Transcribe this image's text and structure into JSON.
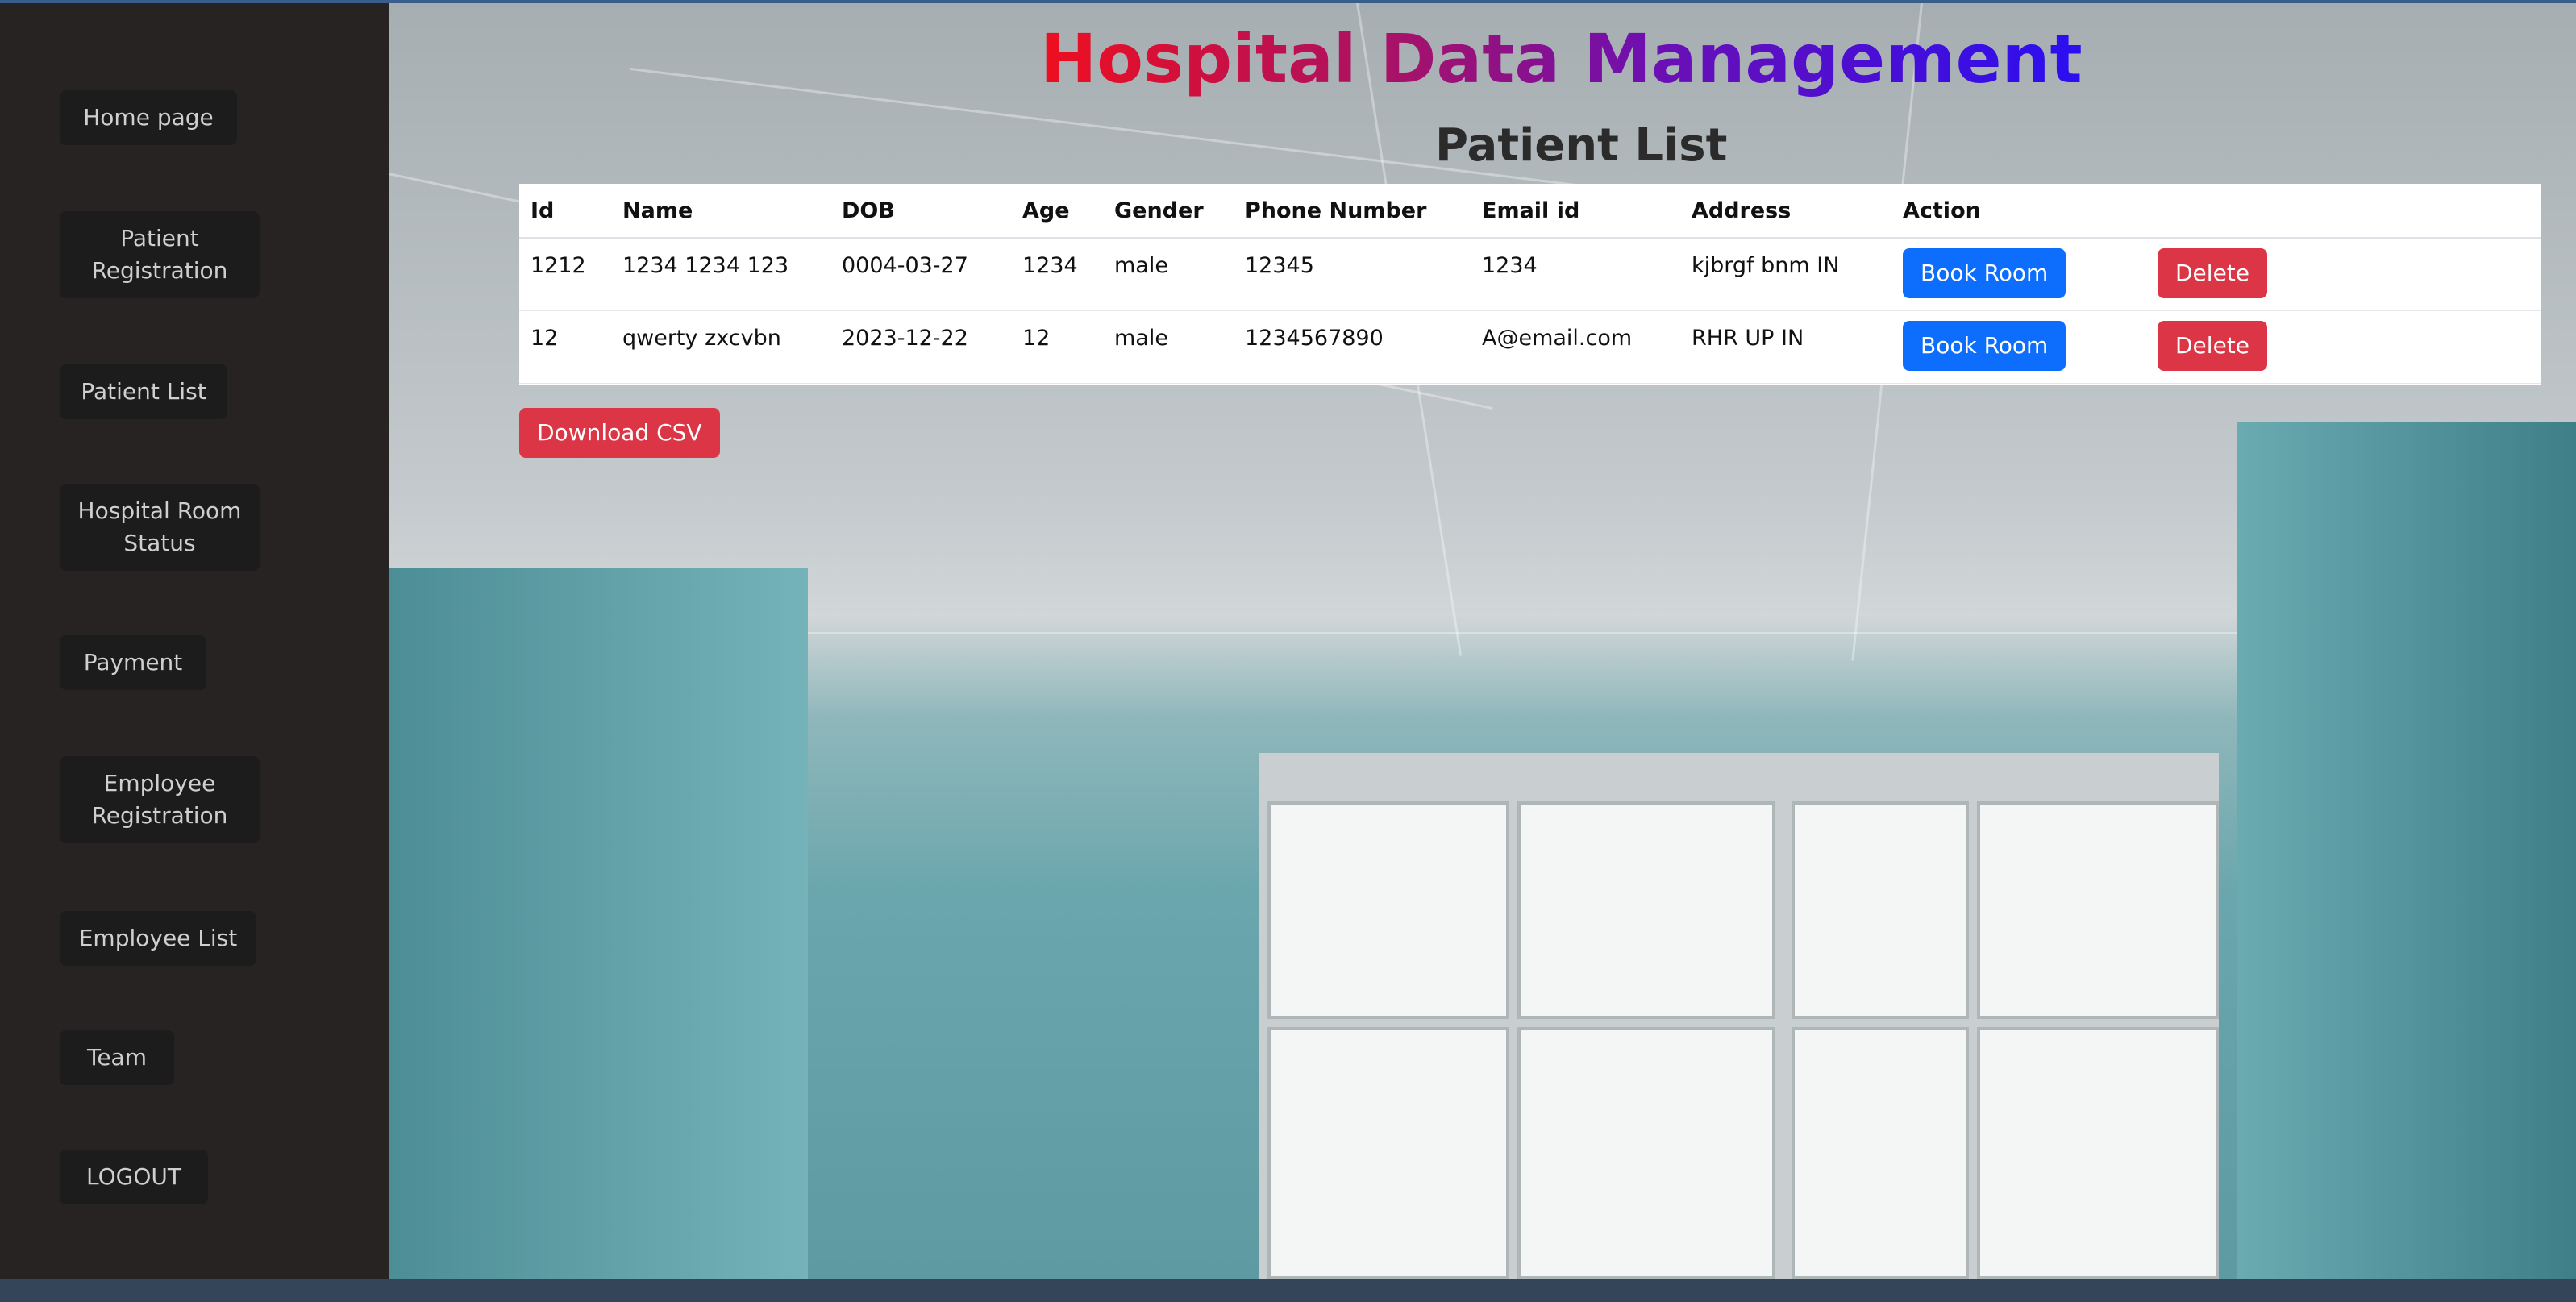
{
  "sidebar": {
    "items": [
      {
        "label": "Home page"
      },
      {
        "label": "Patient Registration"
      },
      {
        "label": "Patient List"
      },
      {
        "label": "Hospital Room Status"
      },
      {
        "label": "Payment"
      },
      {
        "label": "Employee Registration"
      },
      {
        "label": "Employee List"
      },
      {
        "label": "Team"
      },
      {
        "label": "LOGOUT"
      }
    ]
  },
  "header": {
    "title": "Hospital Data Management",
    "subtitle": "Patient List"
  },
  "table": {
    "columns": [
      "Id",
      "Name",
      "DOB",
      "Age",
      "Gender",
      "Phone Number",
      "Email id",
      "Address",
      "Action",
      ""
    ],
    "rows": [
      {
        "id": "1212",
        "name": "1234 1234 123",
        "dob": "0004-03-27",
        "age": "1234",
        "gender": "male",
        "phone": "12345",
        "email": "1234",
        "address": "kjbrgf bnm IN",
        "book_label": "Book Room",
        "delete_label": "Delete"
      },
      {
        "id": "12",
        "name": "qwerty zxcvbn",
        "dob": "2023-12-22",
        "age": "12",
        "gender": "male",
        "phone": "1234567890",
        "email": "A@email.com",
        "address": "RHR UP IN",
        "book_label": "Book Room",
        "delete_label": "Delete"
      }
    ]
  },
  "actions": {
    "download_csv": "Download CSV"
  },
  "colors": {
    "sidebar_bg": "#272322",
    "nav_button_bg": "#1c1c1c",
    "primary": "#0d6efd",
    "danger": "#dc3545",
    "title_gradient_start": "#ee0f1e",
    "title_gradient_end": "#2a0ef2"
  }
}
